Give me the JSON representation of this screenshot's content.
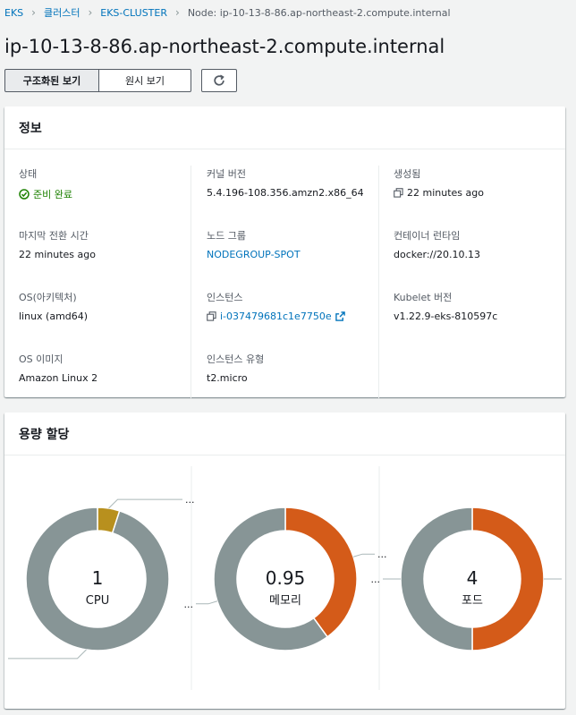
{
  "breadcrumb": [
    {
      "label": "EKS",
      "link": true
    },
    {
      "label": "클러스터",
      "link": true
    },
    {
      "label": "EKS-CLUSTER",
      "link": true
    },
    {
      "label": "Node: ip-10-13-8-86.ap-northeast-2.compute.internal",
      "link": false
    }
  ],
  "page_title": "ip-10-13-8-86.ap-northeast-2.compute.internal",
  "toolbar": {
    "structured_view": "구조화된 보기",
    "raw_view": "원시 보기",
    "refresh_icon": "refresh-icon"
  },
  "info": {
    "title": "정보",
    "status_label": "상태",
    "status_value": "준비 완료",
    "kernel_label": "커널 버전",
    "kernel_value": "5.4.196-108.356.amzn2.x86_64",
    "created_label": "생성됨",
    "created_value": "22 minutes ago",
    "last_transition_label": "마지막 전환 시간",
    "last_transition_value": "22 minutes ago",
    "node_group_label": "노드 그룹",
    "node_group_value": "NODEGROUP-SPOT",
    "runtime_label": "컨테이너 런타임",
    "runtime_value": "docker://20.10.13",
    "os_label": "OS(아키텍처)",
    "os_value": "linux (amd64)",
    "instance_label": "인스턴스",
    "instance_value": "i-037479681c1e7750e",
    "kubelet_label": "Kubelet 버전",
    "kubelet_value": "v1.22.9-eks-810597c",
    "os_image_label": "OS 이미지",
    "os_image_value": "Amazon Linux 2",
    "instance_type_label": "인스턴스 유형",
    "instance_type_value": "t2.micro"
  },
  "capacity": {
    "title": "용량 할당",
    "ellipsis": "...",
    "colors": {
      "gray": "#879596",
      "gold": "#b8901e",
      "orange": "#d45b19"
    },
    "charts": [
      {
        "total": "1",
        "unit": "CPU",
        "segments": [
          {
            "fraction": 0.05,
            "color": "gold"
          },
          {
            "fraction": 0.95,
            "color": "gray"
          }
        ]
      },
      {
        "total": "0.95",
        "unit": "메모리",
        "segments": [
          {
            "fraction": 0.4,
            "color": "orange"
          },
          {
            "fraction": 0.6,
            "color": "gray"
          }
        ]
      },
      {
        "total": "4",
        "unit": "포드",
        "segments": [
          {
            "fraction": 0.5,
            "color": "orange"
          },
          {
            "fraction": 0.5,
            "color": "gray"
          }
        ]
      }
    ]
  }
}
